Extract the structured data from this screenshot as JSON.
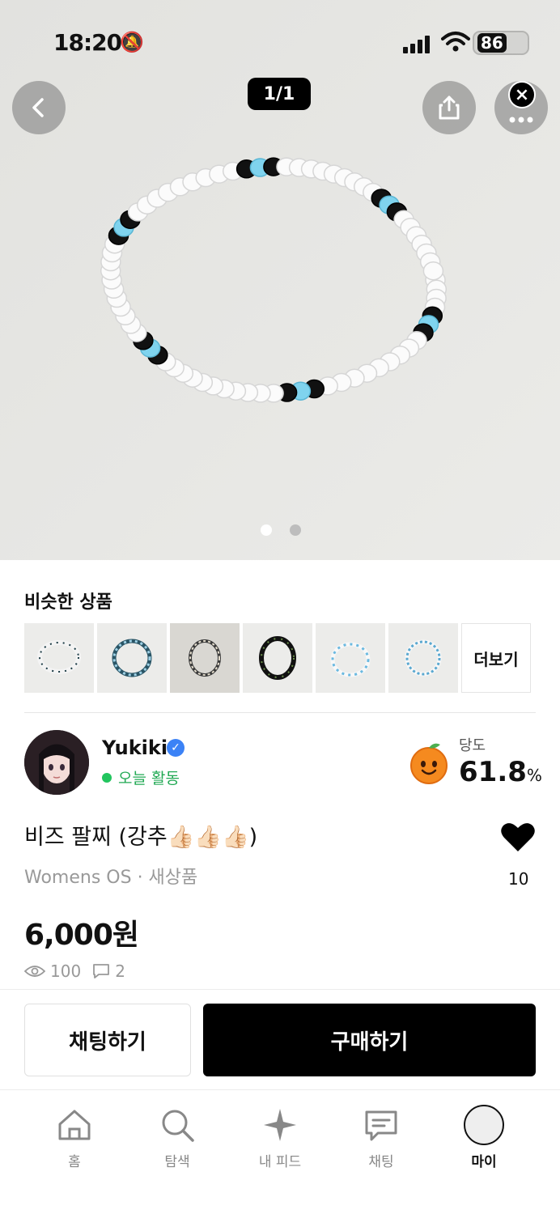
{
  "status_bar": {
    "time": "18:20",
    "battery": "86"
  },
  "hero": {
    "counter": "1/1",
    "page_index": 0,
    "page_count": 2
  },
  "similar": {
    "title": "비슷한 상품",
    "more_label": "더보기"
  },
  "seller": {
    "name": "Yukiki",
    "activity": "오늘 활동",
    "sweetness_label": "당도",
    "sweetness_value": "61.8",
    "sweetness_unit": "%"
  },
  "product": {
    "title": "비즈 팔찌 (강추👍🏻👍🏻👍🏻)",
    "meta": "Womens OS · 새상품",
    "price": "6,000원",
    "views": "100",
    "comments": "2",
    "likes": "10"
  },
  "actions": {
    "chat_label": "채팅하기",
    "buy_label": "구매하기"
  },
  "tabbar": {
    "items": [
      {
        "label": "홈",
        "icon": "home-icon"
      },
      {
        "label": "탐색",
        "icon": "search-icon"
      },
      {
        "label": "내 피드",
        "icon": "sparkle-icon"
      },
      {
        "label": "채팅",
        "icon": "chat-icon"
      },
      {
        "label": "마이",
        "icon": "profile-icon"
      }
    ]
  },
  "colors": {
    "accent": "#000000",
    "active_green": "#22c55e",
    "verified_blue": "#3b82f6"
  }
}
